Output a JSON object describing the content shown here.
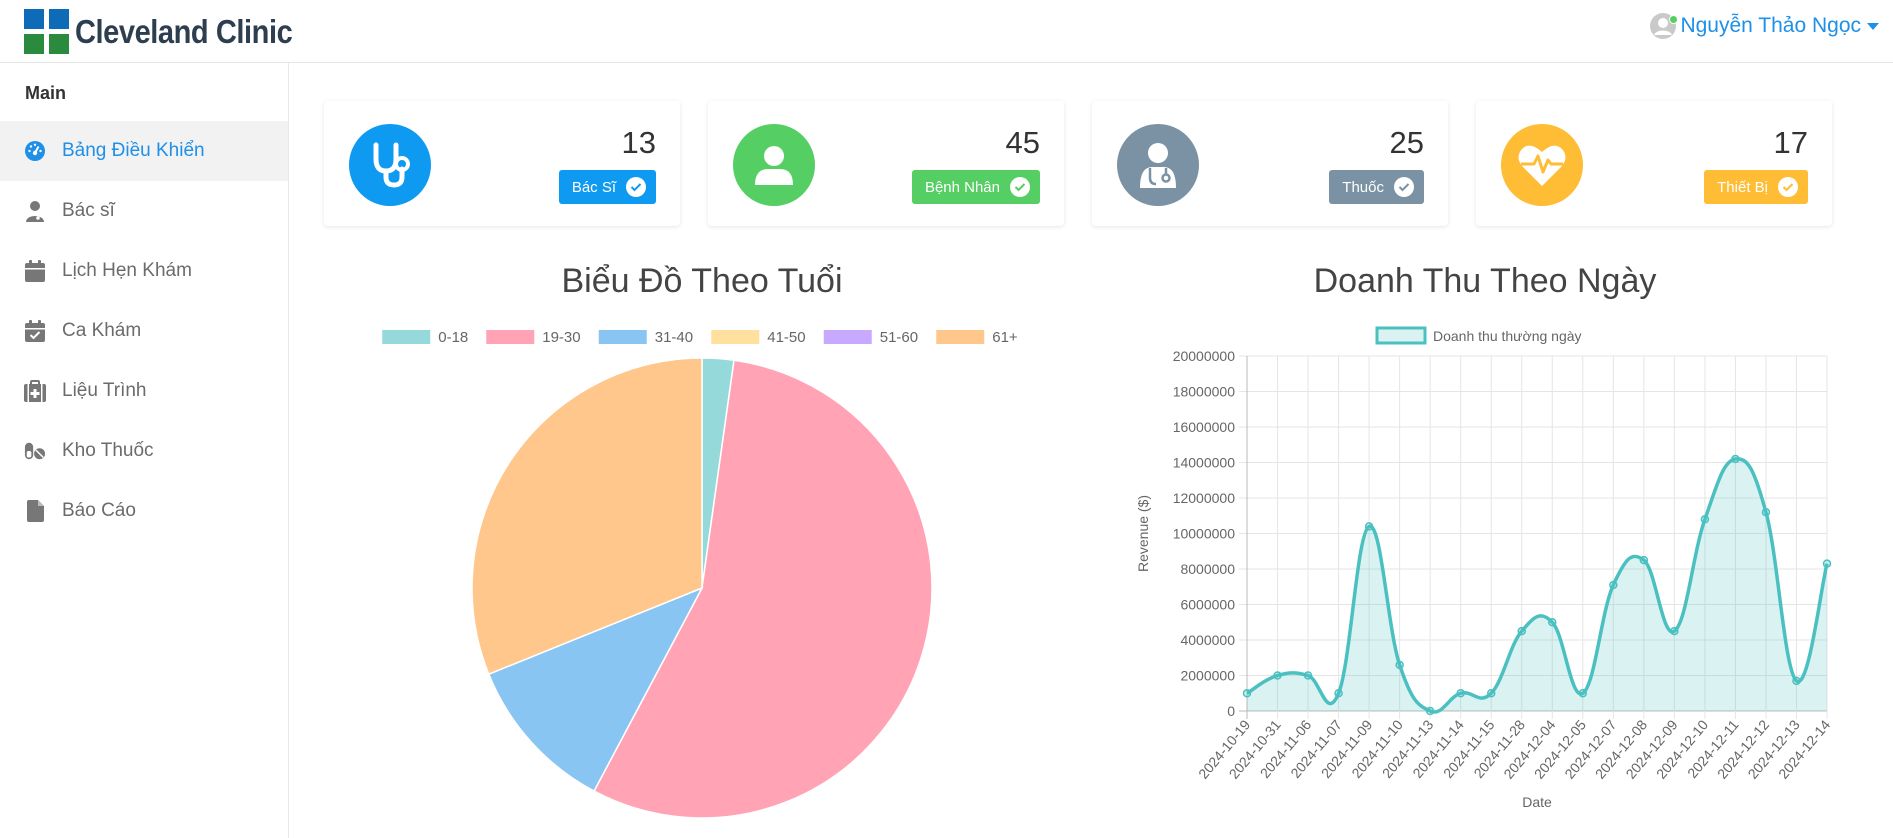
{
  "brand": {
    "name": "Cleveland Clinic"
  },
  "user": {
    "name": "Nguyễn Thảo Ngọc"
  },
  "sidebar": {
    "heading": "Main",
    "items": [
      {
        "label": "Bảng Điều Khiển",
        "icon": "dashboard-icon",
        "active": true
      },
      {
        "label": "Bác sĩ",
        "icon": "doctor-icon"
      },
      {
        "label": "Lịch Hẹn Khám",
        "icon": "calendar-icon"
      },
      {
        "label": "Ca Khám",
        "icon": "calendar-check-icon"
      },
      {
        "label": "Liệu Trình",
        "icon": "medkit-icon"
      },
      {
        "label": "Kho Thuốc",
        "icon": "pills-icon"
      },
      {
        "label": "Báo Cáo",
        "icon": "file-icon"
      }
    ]
  },
  "stats": [
    {
      "value": "13",
      "label": "Bác Sĩ",
      "icon": "stethoscope-icon",
      "color": "#0d9af0"
    },
    {
      "value": "45",
      "label": "Bệnh Nhân",
      "icon": "user-icon",
      "color": "#55ce63"
    },
    {
      "value": "25",
      "label": "Thuốc",
      "icon": "user-doctor-icon",
      "color": "#7a92a3"
    },
    {
      "value": "17",
      "label": "Thiết Bị",
      "icon": "heartbeat-icon",
      "color": "#ffbc35"
    }
  ],
  "chart_data": [
    {
      "type": "pie",
      "title": "Biểu Đồ Theo Tuổi",
      "legend_position": "top",
      "categories": [
        "0-18",
        "19-30",
        "31-40",
        "41-50",
        "51-60",
        "61+"
      ],
      "values": [
        1,
        25,
        5,
        0,
        0,
        14
      ],
      "colors": [
        "#96d9db",
        "#ffa3b5",
        "#88c5f3",
        "#ffe09e",
        "#c7aaff",
        "#ffc78c"
      ]
    },
    {
      "type": "line",
      "title": "Doanh Thu Theo Ngày",
      "legend_position": "top",
      "series": [
        {
          "name": "Doanh thu thường ngày",
          "color": "#4bc0c0",
          "values": [
            1000000,
            2000000,
            2000000,
            1000000,
            10400000,
            2600000,
            0,
            1000000,
            1000000,
            4500000,
            5000000,
            1000000,
            7100000,
            8500000,
            4500000,
            10800000,
            14200000,
            11200000,
            1700000,
            8300000
          ]
        }
      ],
      "x": [
        "2024-10-19",
        "2024-10-31",
        "2024-11-06",
        "2024-11-07",
        "2024-11-09",
        "2024-11-10",
        "2024-11-13",
        "2024-11-14",
        "2024-11-15",
        "2024-11-28",
        "2024-12-04",
        "2024-12-05",
        "2024-12-07",
        "2024-12-08",
        "2024-12-09",
        "2024-12-10",
        "2024-12-11",
        "2024-12-12",
        "2024-12-13",
        "2024-12-14"
      ],
      "xlabel": "Date",
      "ylabel": "Revenue ($)",
      "ylim": [
        0,
        20000000
      ],
      "yticks": [
        "0",
        "2000000",
        "4000000",
        "6000000",
        "8000000",
        "10000000",
        "12000000",
        "14000000",
        "16000000",
        "18000000",
        "20000000"
      ],
      "grid": true,
      "fill": true
    }
  ]
}
